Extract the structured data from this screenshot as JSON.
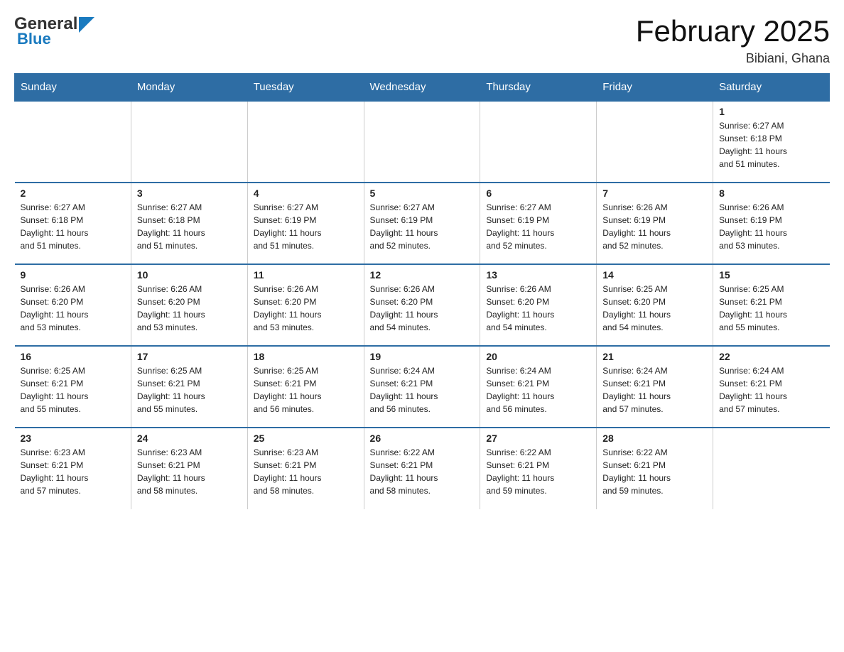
{
  "logo": {
    "general": "General",
    "blue": "Blue"
  },
  "title": "February 2025",
  "location": "Bibiani, Ghana",
  "days_of_week": [
    "Sunday",
    "Monday",
    "Tuesday",
    "Wednesday",
    "Thursday",
    "Friday",
    "Saturday"
  ],
  "weeks": [
    [
      {
        "day": "",
        "info": ""
      },
      {
        "day": "",
        "info": ""
      },
      {
        "day": "",
        "info": ""
      },
      {
        "day": "",
        "info": ""
      },
      {
        "day": "",
        "info": ""
      },
      {
        "day": "",
        "info": ""
      },
      {
        "day": "1",
        "info": "Sunrise: 6:27 AM\nSunset: 6:18 PM\nDaylight: 11 hours\nand 51 minutes."
      }
    ],
    [
      {
        "day": "2",
        "info": "Sunrise: 6:27 AM\nSunset: 6:18 PM\nDaylight: 11 hours\nand 51 minutes."
      },
      {
        "day": "3",
        "info": "Sunrise: 6:27 AM\nSunset: 6:18 PM\nDaylight: 11 hours\nand 51 minutes."
      },
      {
        "day": "4",
        "info": "Sunrise: 6:27 AM\nSunset: 6:19 PM\nDaylight: 11 hours\nand 51 minutes."
      },
      {
        "day": "5",
        "info": "Sunrise: 6:27 AM\nSunset: 6:19 PM\nDaylight: 11 hours\nand 52 minutes."
      },
      {
        "day": "6",
        "info": "Sunrise: 6:27 AM\nSunset: 6:19 PM\nDaylight: 11 hours\nand 52 minutes."
      },
      {
        "day": "7",
        "info": "Sunrise: 6:26 AM\nSunset: 6:19 PM\nDaylight: 11 hours\nand 52 minutes."
      },
      {
        "day": "8",
        "info": "Sunrise: 6:26 AM\nSunset: 6:19 PM\nDaylight: 11 hours\nand 53 minutes."
      }
    ],
    [
      {
        "day": "9",
        "info": "Sunrise: 6:26 AM\nSunset: 6:20 PM\nDaylight: 11 hours\nand 53 minutes."
      },
      {
        "day": "10",
        "info": "Sunrise: 6:26 AM\nSunset: 6:20 PM\nDaylight: 11 hours\nand 53 minutes."
      },
      {
        "day": "11",
        "info": "Sunrise: 6:26 AM\nSunset: 6:20 PM\nDaylight: 11 hours\nand 53 minutes."
      },
      {
        "day": "12",
        "info": "Sunrise: 6:26 AM\nSunset: 6:20 PM\nDaylight: 11 hours\nand 54 minutes."
      },
      {
        "day": "13",
        "info": "Sunrise: 6:26 AM\nSunset: 6:20 PM\nDaylight: 11 hours\nand 54 minutes."
      },
      {
        "day": "14",
        "info": "Sunrise: 6:25 AM\nSunset: 6:20 PM\nDaylight: 11 hours\nand 54 minutes."
      },
      {
        "day": "15",
        "info": "Sunrise: 6:25 AM\nSunset: 6:21 PM\nDaylight: 11 hours\nand 55 minutes."
      }
    ],
    [
      {
        "day": "16",
        "info": "Sunrise: 6:25 AM\nSunset: 6:21 PM\nDaylight: 11 hours\nand 55 minutes."
      },
      {
        "day": "17",
        "info": "Sunrise: 6:25 AM\nSunset: 6:21 PM\nDaylight: 11 hours\nand 55 minutes."
      },
      {
        "day": "18",
        "info": "Sunrise: 6:25 AM\nSunset: 6:21 PM\nDaylight: 11 hours\nand 56 minutes."
      },
      {
        "day": "19",
        "info": "Sunrise: 6:24 AM\nSunset: 6:21 PM\nDaylight: 11 hours\nand 56 minutes."
      },
      {
        "day": "20",
        "info": "Sunrise: 6:24 AM\nSunset: 6:21 PM\nDaylight: 11 hours\nand 56 minutes."
      },
      {
        "day": "21",
        "info": "Sunrise: 6:24 AM\nSunset: 6:21 PM\nDaylight: 11 hours\nand 57 minutes."
      },
      {
        "day": "22",
        "info": "Sunrise: 6:24 AM\nSunset: 6:21 PM\nDaylight: 11 hours\nand 57 minutes."
      }
    ],
    [
      {
        "day": "23",
        "info": "Sunrise: 6:23 AM\nSunset: 6:21 PM\nDaylight: 11 hours\nand 57 minutes."
      },
      {
        "day": "24",
        "info": "Sunrise: 6:23 AM\nSunset: 6:21 PM\nDaylight: 11 hours\nand 58 minutes."
      },
      {
        "day": "25",
        "info": "Sunrise: 6:23 AM\nSunset: 6:21 PM\nDaylight: 11 hours\nand 58 minutes."
      },
      {
        "day": "26",
        "info": "Sunrise: 6:22 AM\nSunset: 6:21 PM\nDaylight: 11 hours\nand 58 minutes."
      },
      {
        "day": "27",
        "info": "Sunrise: 6:22 AM\nSunset: 6:21 PM\nDaylight: 11 hours\nand 59 minutes."
      },
      {
        "day": "28",
        "info": "Sunrise: 6:22 AM\nSunset: 6:21 PM\nDaylight: 11 hours\nand 59 minutes."
      },
      {
        "day": "",
        "info": ""
      }
    ]
  ]
}
